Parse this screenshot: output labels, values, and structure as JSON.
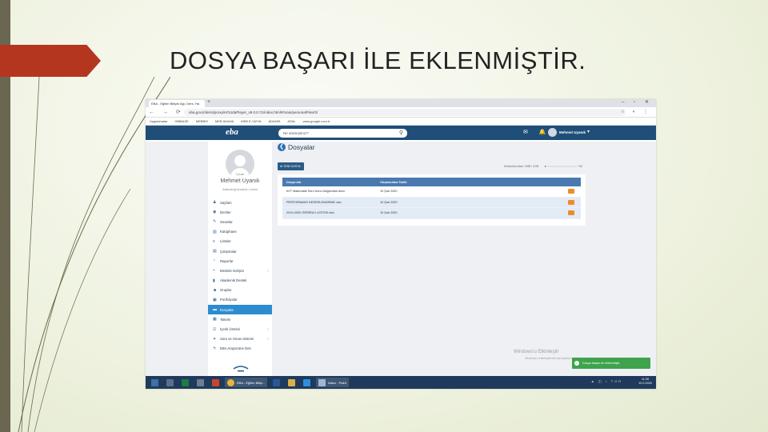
{
  "slide": {
    "title": "DOSYA BAŞARI İLE EKLENMİŞTİR."
  },
  "browser": {
    "tab_title": "EBA - Eğitim Bilişim Ağı, Ders, Ha",
    "new_tab": "+",
    "window_controls": "– ▫ ✕",
    "nav_icons": "← → ⟳ ⌂",
    "url": "eba.gov.tr/dersi/proxy/HOUdaPlayer_v9.0.0.71/index.html#/main/personalFiles/2/",
    "addr_icons": "☆ ◐ ⋮",
    "bookmarks": [
      "Uygulamalar",
      "HIBBASE",
      "MEBBIS",
      "MEB ADANA",
      "MEB E-YAYIN",
      "ADANIS",
      "ASAL",
      "www.google.com.tr"
    ]
  },
  "eba": {
    "logo": "eba",
    "search_placeholder": "Ne aramıştınız?",
    "search_icon": "⚲",
    "header_icons": "✉ 🔔",
    "user": "Mehmet Uyanık",
    "caret": "▾"
  },
  "profile": {
    "tag": "3 puan",
    "name": "Mehmet Uyanık",
    "school": "Adanıkoğ Anadolu Lisesi"
  },
  "menu": [
    {
      "icon": "person-icon",
      "glyph": "♟",
      "label": "Sayfam",
      "caret": ""
    },
    {
      "icon": "lessons-icon",
      "glyph": "◉",
      "label": "Dersler",
      "caret": ""
    },
    {
      "icon": "pencil-icon",
      "glyph": "✎",
      "label": "Sınavlar",
      "caret": ""
    },
    {
      "icon": "library-icon",
      "glyph": "▥",
      "label": "Kütüphane",
      "caret": ""
    },
    {
      "icon": "list-icon",
      "glyph": "≡",
      "label": "Listeler",
      "caret": ""
    },
    {
      "icon": "work-icon",
      "glyph": "▤",
      "label": "Çalışmalar",
      "caret": ""
    },
    {
      "icon": "report-icon",
      "glyph": "◔",
      "label": "Raporlar",
      "caret": ""
    },
    {
      "icon": "growth-icon",
      "glyph": "⌁",
      "label": "Mesleki Gelişim",
      "caret": "˅"
    },
    {
      "icon": "chart-icon",
      "glyph": "▮",
      "label": "Akademik Destek",
      "caret": ""
    },
    {
      "icon": "group-icon",
      "glyph": "☻",
      "label": "Gruplar",
      "caret": ""
    },
    {
      "icon": "portfolio-icon",
      "glyph": "▣",
      "label": "Portfolyolar",
      "caret": ""
    },
    {
      "icon": "folder-icon",
      "glyph": "▬",
      "label": "Dosyalar",
      "caret": ""
    },
    {
      "icon": "calendar-icon",
      "glyph": "▦",
      "label": "Takvim",
      "caret": ""
    },
    {
      "icon": "checkbox-icon",
      "glyph": "☑",
      "label": "İçerik Üretimi",
      "caret": "˅"
    },
    {
      "icon": "exam-icon",
      "glyph": "✦",
      "label": "Soru ve Sınav Sistemi",
      "caret": "˅"
    },
    {
      "icon": "back-icon",
      "glyph": "↰",
      "label": "EBA Arayüzüne Dön",
      "caret": ""
    }
  ],
  "files": {
    "title": "Dosyalar",
    "back_glyph": "❮",
    "new_folder": "⊕ YENİ DOSYA",
    "quota_label": "Kullanılan Alan: 1MB / 2GB",
    "quota_fraction": 0.03,
    "quota_pct": "%1",
    "headers": {
      "name": "Dosya Adı",
      "date": "Oluşturulma Tarihi"
    },
    "rows": [
      {
        "name": "AYT Matematik Soru Konu Dağılımları.docx",
        "date": "10 Şub 2020"
      },
      {
        "name": "PERFORMANS DEĞERLENDİRME.xlsx",
        "date": "10 Şub 2020"
      },
      {
        "name": "2019-2020 ÖĞRENCİ LİSTESİ.xlsx",
        "date": "10 Şub 2020"
      }
    ]
  },
  "overlay": {
    "watermark": "Windows'u Etkinleştir",
    "watermark_sub": "Windows'u etkinleştirmek için Ayarlar'a gidin.",
    "toast": "Dosya başarı ile eklenmiştir."
  },
  "taskbar": {
    "items": [
      {
        "name": "task-view-icon",
        "color": "#5b6f8a"
      },
      {
        "name": "excel-icon",
        "color": "#1f7a44"
      },
      {
        "name": "calculator-icon",
        "color": "#6d7c8f"
      },
      {
        "name": "powerpoint-icon",
        "color": "#c8452b"
      }
    ],
    "chrome_label": "EBA - Eğitim Bilişi...",
    "word_color": "#2b5797",
    "paint_label": "Adsız - Paint",
    "clock_time": "11:26",
    "clock_date": "10.2.2020",
    "tray": "▲ ◫ ♪ TÜR"
  }
}
